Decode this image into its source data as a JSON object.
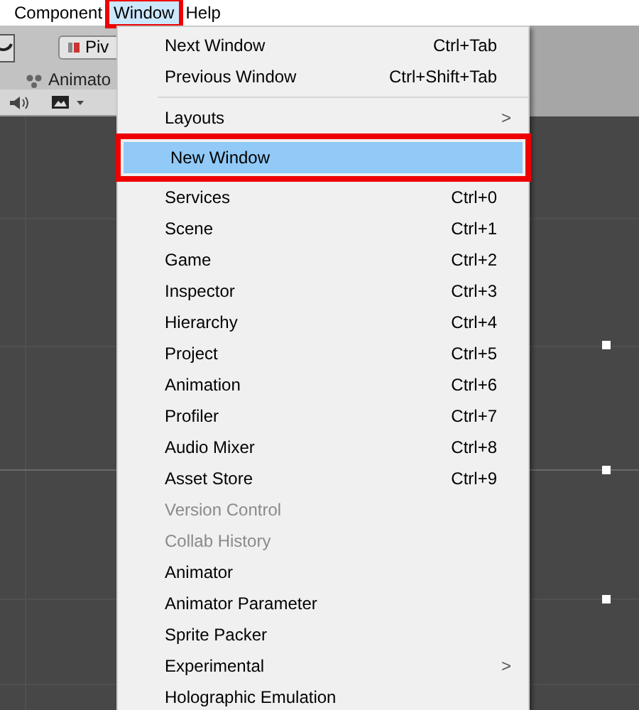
{
  "menubar": [
    {
      "label": "Component",
      "selected": false,
      "outlined": false
    },
    {
      "label": "Window",
      "selected": true,
      "outlined": true
    },
    {
      "label": "Help",
      "selected": false,
      "outlined": false
    }
  ],
  "toolbar": {
    "pivot_button": "Piv",
    "tab": "Animato"
  },
  "menu": [
    {
      "kind": "item",
      "label": "Next Window",
      "shortcut": "Ctrl+Tab",
      "disabled": false,
      "selected": false,
      "outlined": false
    },
    {
      "kind": "item",
      "label": "Previous Window",
      "shortcut": "Ctrl+Shift+Tab",
      "disabled": false,
      "selected": false,
      "outlined": false
    },
    {
      "kind": "separator"
    },
    {
      "kind": "submenu",
      "label": "Layouts",
      "arrow": ">",
      "disabled": false,
      "selected": false,
      "outlined": false
    },
    {
      "kind": "item",
      "label": "New Window",
      "disabled": false,
      "selected": true,
      "outlined": true
    },
    {
      "kind": "item",
      "label": "Services",
      "shortcut": "Ctrl+0",
      "disabled": false,
      "selected": false,
      "outlined": false
    },
    {
      "kind": "item",
      "label": "Scene",
      "shortcut": "Ctrl+1",
      "disabled": false,
      "selected": false,
      "outlined": false
    },
    {
      "kind": "item",
      "label": "Game",
      "shortcut": "Ctrl+2",
      "disabled": false,
      "selected": false,
      "outlined": false
    },
    {
      "kind": "item",
      "label": "Inspector",
      "shortcut": "Ctrl+3",
      "disabled": false,
      "selected": false,
      "outlined": false
    },
    {
      "kind": "item",
      "label": "Hierarchy",
      "shortcut": "Ctrl+4",
      "disabled": false,
      "selected": false,
      "outlined": false
    },
    {
      "kind": "item",
      "label": "Project",
      "shortcut": "Ctrl+5",
      "disabled": false,
      "selected": false,
      "outlined": false
    },
    {
      "kind": "item",
      "label": "Animation",
      "shortcut": "Ctrl+6",
      "disabled": false,
      "selected": false,
      "outlined": false
    },
    {
      "kind": "item",
      "label": "Profiler",
      "shortcut": "Ctrl+7",
      "disabled": false,
      "selected": false,
      "outlined": false
    },
    {
      "kind": "item",
      "label": "Audio Mixer",
      "shortcut": "Ctrl+8",
      "disabled": false,
      "selected": false,
      "outlined": false
    },
    {
      "kind": "item",
      "label": "Asset Store",
      "shortcut": "Ctrl+9",
      "disabled": false,
      "selected": false,
      "outlined": false
    },
    {
      "kind": "item",
      "label": "Version Control",
      "disabled": true,
      "selected": false,
      "outlined": false
    },
    {
      "kind": "item",
      "label": "Collab History",
      "disabled": true,
      "selected": false,
      "outlined": false
    },
    {
      "kind": "item",
      "label": "Animator",
      "disabled": false,
      "selected": false,
      "outlined": false
    },
    {
      "kind": "item",
      "label": "Animator Parameter",
      "disabled": false,
      "selected": false,
      "outlined": false
    },
    {
      "kind": "item",
      "label": "Sprite Packer",
      "disabled": false,
      "selected": false,
      "outlined": false
    },
    {
      "kind": "submenu",
      "label": "Experimental",
      "arrow": ">",
      "disabled": false,
      "selected": false,
      "outlined": false
    },
    {
      "kind": "item",
      "label": "Holographic Emulation",
      "disabled": false,
      "selected": false,
      "outlined": false
    }
  ]
}
